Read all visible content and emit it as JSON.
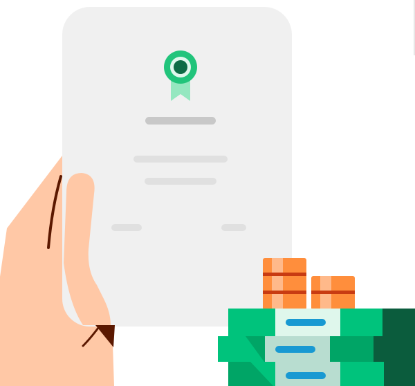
{
  "illustration": {
    "colors": {
      "paper": "#f0f0f0",
      "placeholder_dark": "#c8c8c8",
      "placeholder_light": "#e0e0e0",
      "badge_ring": "#21c47b",
      "badge_inner": "#0d6b45",
      "badge_ribbon": "#95e7c0",
      "skin": "#ffc8a6",
      "hair_line": "#5b1800",
      "money_green": "#00c37c",
      "money_mid": "#00a566",
      "money_dark": "#0b5c3d",
      "money_band": "#b8ddd0",
      "money_slot": "#1899d2",
      "coin": "#ff8e3c",
      "coin_light": "#ffb98a",
      "coin_stripe": "#c83b12"
    },
    "icons": [
      "certificate-document-icon",
      "award-badge-icon",
      "hand-icon",
      "banknote-stack-icon",
      "coin-stack-icon"
    ]
  }
}
